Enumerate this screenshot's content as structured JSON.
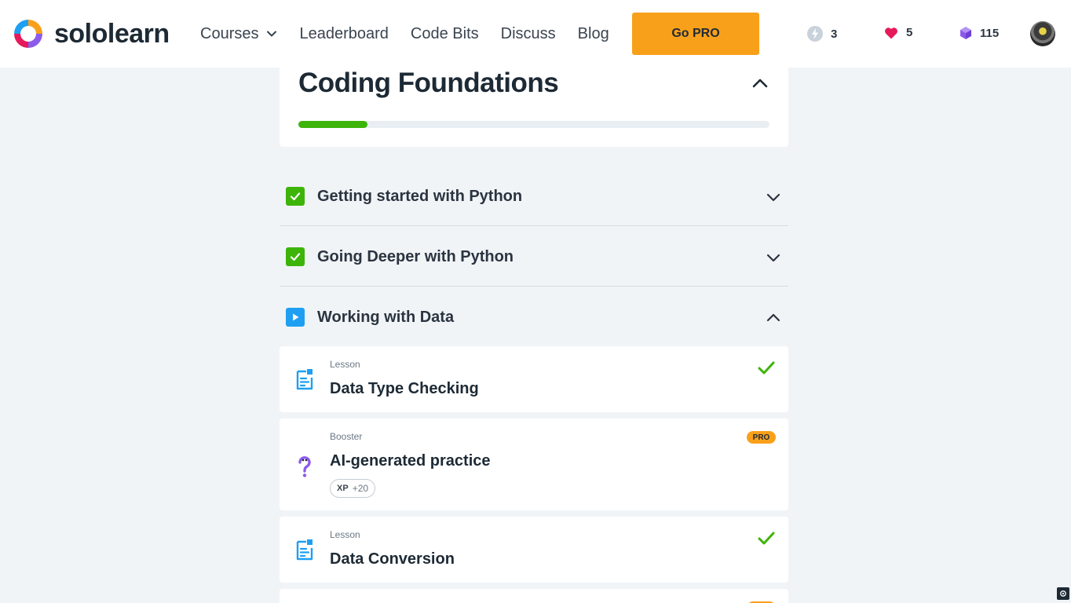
{
  "header": {
    "logo_text": "sololearn",
    "nav": {
      "courses": "Courses",
      "leaderboard": "Leaderboard",
      "code_bits": "Code Bits",
      "discuss": "Discuss",
      "blog": "Blog"
    },
    "go_pro": "Go PRO",
    "stats": {
      "streak": "3",
      "hearts": "5",
      "bits": "115"
    }
  },
  "course": {
    "title": "Coding Foundations",
    "progress_fraction": 0.147
  },
  "modules": [
    {
      "title": "Getting started with Python",
      "status": "completed",
      "expanded": false
    },
    {
      "title": "Going Deeper with Python",
      "status": "completed",
      "expanded": false
    },
    {
      "title": "Working with Data",
      "status": "in-progress",
      "expanded": true
    }
  ],
  "lessons": [
    {
      "type": "Lesson",
      "title": "Data Type Checking",
      "completed": true
    },
    {
      "type": "Booster",
      "title": "AI-generated practice",
      "badge": "PRO",
      "xp_label": "XP",
      "xp_value": "+20"
    },
    {
      "type": "Lesson",
      "title": "Data Conversion",
      "completed": true
    }
  ],
  "colors": {
    "accent_orange": "#f9a01b",
    "success_green": "#3db40a",
    "play_blue": "#1e9ff2",
    "heart_pink": "#e6195a",
    "gem_purple": "#8d5bea"
  }
}
